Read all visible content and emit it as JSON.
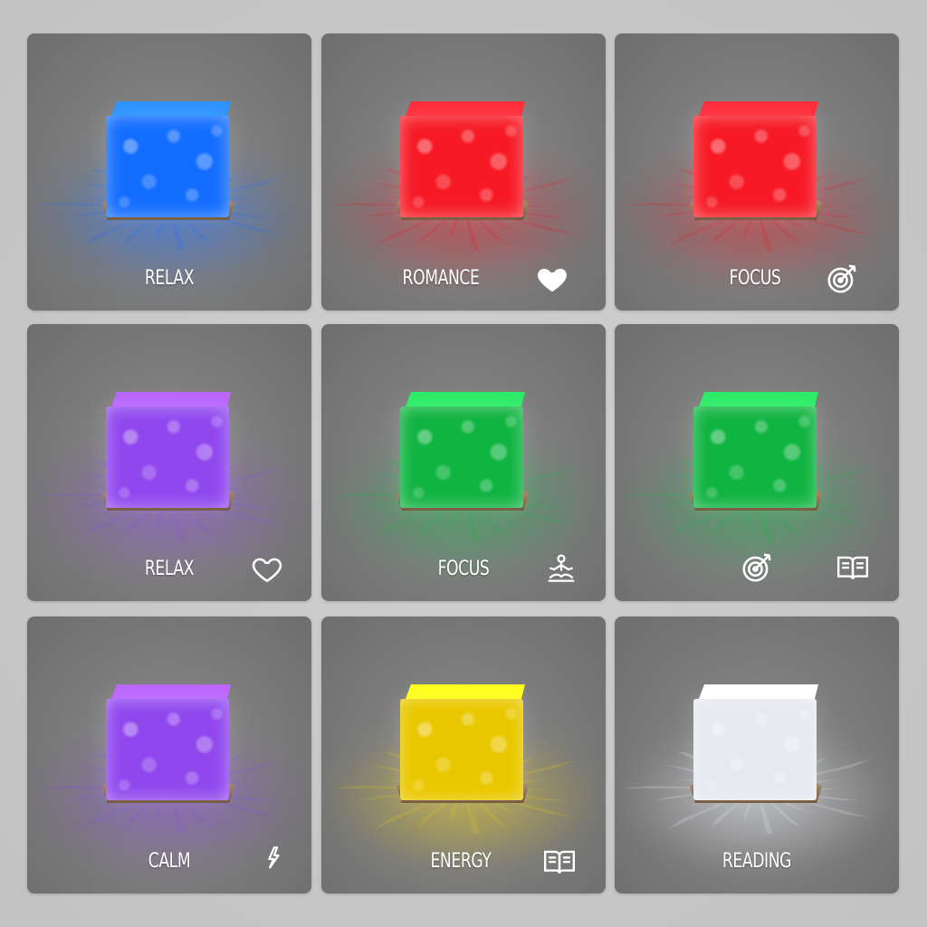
{
  "tiles": [
    {
      "label": "RELAX",
      "color": "#1e6cff",
      "icons": []
    },
    {
      "label": "ROMANCE",
      "color": "#e0202a",
      "icons": [
        "heart-filled-icon"
      ]
    },
    {
      "label": "FOCUS",
      "color": "#e0202a",
      "icons": [
        "target-arrow-icon"
      ]
    },
    {
      "label": "RELAX",
      "color": "#8a4bdc",
      "icons": [
        "heart-outline-icon"
      ]
    },
    {
      "label": "FOCUS",
      "color": "#1fae4a",
      "icons": [
        "meditation-icon"
      ]
    },
    {
      "label": "",
      "color": "#1fae4a",
      "icons": [
        "target-arrow-icon",
        "book-icon"
      ]
    },
    {
      "label": "CALM",
      "color": "#8a4bdc",
      "icons": [
        "moon-bolt-icon"
      ]
    },
    {
      "label": "ENERGY",
      "color": "#e4c614",
      "icons": [
        "book-icon"
      ]
    },
    {
      "label": "READING",
      "color": "#e6e9ee",
      "icons": []
    }
  ]
}
